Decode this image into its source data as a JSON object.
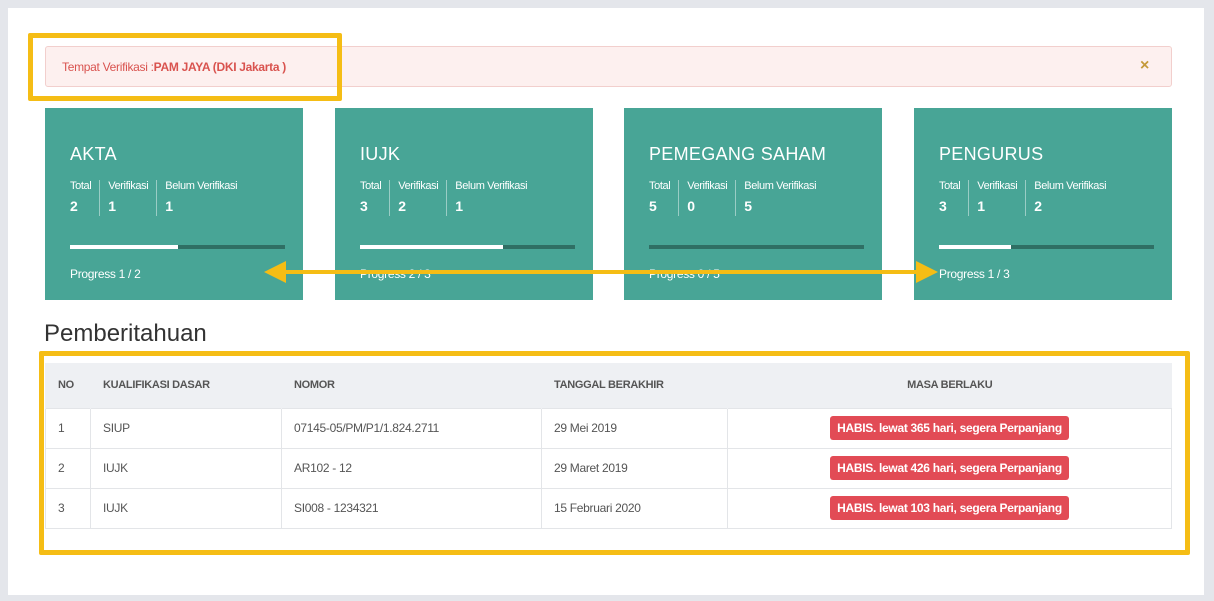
{
  "alert": {
    "label": "Tempat Verifikasi : ",
    "value": "PAM JAYA (DKI Jakarta )",
    "close": "×"
  },
  "cards": [
    {
      "title": "AKTA",
      "total_label": "Total",
      "verif_label": "Verifikasi",
      "belum_label": "Belum Verifikasi",
      "total": "2",
      "verifikasi": "1",
      "belum": "1",
      "progress_text": "Progress 1 / 2",
      "progress": 0.5
    },
    {
      "title": "IUJK",
      "total_label": "Total",
      "verif_label": "Verifikasi",
      "belum_label": "Belum Verifikasi",
      "total": "3",
      "verifikasi": "2",
      "belum": "1",
      "progress_text": "Progress 2 / 3",
      "progress": 0.667
    },
    {
      "title": "PEMEGANG SAHAM",
      "total_label": "Total",
      "verif_label": "Verifikasi",
      "belum_label": "Belum Verifikasi",
      "total": "5",
      "verifikasi": "0",
      "belum": "5",
      "progress_text": "Progress 0 / 5",
      "progress": 0
    },
    {
      "title": "PENGURUS",
      "total_label": "Total",
      "verif_label": "Verifikasi",
      "belum_label": "Belum Verifikasi",
      "total": "3",
      "verifikasi": "1",
      "belum": "2",
      "progress_text": "Progress 1 / 3",
      "progress": 0.333
    }
  ],
  "notice": {
    "title": "Pemberitahuan",
    "headers": [
      "NO",
      "KUALIFIKASI DASAR",
      "NOMOR",
      "TANGGAL BERAKHIR",
      "MASA BERLAKU"
    ],
    "rows": [
      {
        "no": "1",
        "kualifikasi": "SIUP",
        "nomor": "07145-05/PM/P1/1.824.2711",
        "tanggal": "29 Mei 2019",
        "masa": "HABIS. lewat 365 hari, segera Perpanjang"
      },
      {
        "no": "2",
        "kualifikasi": "IUJK",
        "nomor": "AR102 - 12",
        "tanggal": "29 Maret 2019",
        "masa": "HABIS. lewat 426 hari, segera Perpanjang"
      },
      {
        "no": "3",
        "kualifikasi": "IUJK",
        "nomor": "SI008 - 1234321",
        "tanggal": "15 Februari 2020",
        "masa": "HABIS. lewat 103 hari, segera Perpanjang"
      }
    ]
  },
  "colors": {
    "card": "#48a596",
    "highlight": "#f5bd15",
    "badge": "#e24b55",
    "alert_text": "#d9534f"
  }
}
